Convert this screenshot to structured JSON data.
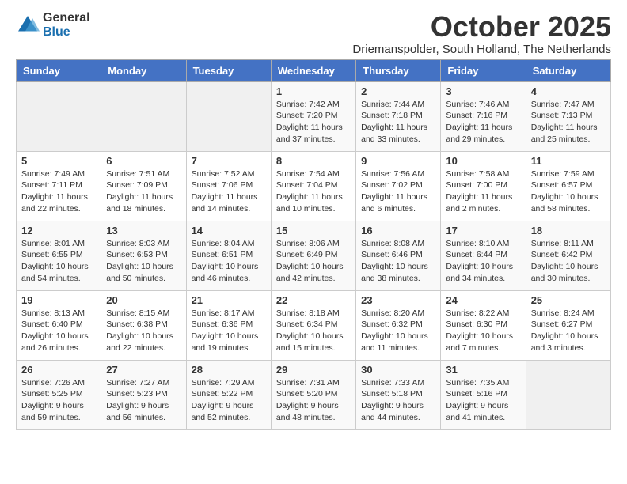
{
  "logo": {
    "general": "General",
    "blue": "Blue"
  },
  "header": {
    "month": "October 2025",
    "location": "Driemanspolder, South Holland, The Netherlands"
  },
  "weekdays": [
    "Sunday",
    "Monday",
    "Tuesday",
    "Wednesday",
    "Thursday",
    "Friday",
    "Saturday"
  ],
  "weeks": [
    [
      {
        "day": "",
        "sunrise": "",
        "sunset": "",
        "daylight": ""
      },
      {
        "day": "",
        "sunrise": "",
        "sunset": "",
        "daylight": ""
      },
      {
        "day": "",
        "sunrise": "",
        "sunset": "",
        "daylight": ""
      },
      {
        "day": "1",
        "sunrise": "Sunrise: 7:42 AM",
        "sunset": "Sunset: 7:20 PM",
        "daylight": "Daylight: 11 hours and 37 minutes."
      },
      {
        "day": "2",
        "sunrise": "Sunrise: 7:44 AM",
        "sunset": "Sunset: 7:18 PM",
        "daylight": "Daylight: 11 hours and 33 minutes."
      },
      {
        "day": "3",
        "sunrise": "Sunrise: 7:46 AM",
        "sunset": "Sunset: 7:16 PM",
        "daylight": "Daylight: 11 hours and 29 minutes."
      },
      {
        "day": "4",
        "sunrise": "Sunrise: 7:47 AM",
        "sunset": "Sunset: 7:13 PM",
        "daylight": "Daylight: 11 hours and 25 minutes."
      }
    ],
    [
      {
        "day": "5",
        "sunrise": "Sunrise: 7:49 AM",
        "sunset": "Sunset: 7:11 PM",
        "daylight": "Daylight: 11 hours and 22 minutes."
      },
      {
        "day": "6",
        "sunrise": "Sunrise: 7:51 AM",
        "sunset": "Sunset: 7:09 PM",
        "daylight": "Daylight: 11 hours and 18 minutes."
      },
      {
        "day": "7",
        "sunrise": "Sunrise: 7:52 AM",
        "sunset": "Sunset: 7:06 PM",
        "daylight": "Daylight: 11 hours and 14 minutes."
      },
      {
        "day": "8",
        "sunrise": "Sunrise: 7:54 AM",
        "sunset": "Sunset: 7:04 PM",
        "daylight": "Daylight: 11 hours and 10 minutes."
      },
      {
        "day": "9",
        "sunrise": "Sunrise: 7:56 AM",
        "sunset": "Sunset: 7:02 PM",
        "daylight": "Daylight: 11 hours and 6 minutes."
      },
      {
        "day": "10",
        "sunrise": "Sunrise: 7:58 AM",
        "sunset": "Sunset: 7:00 PM",
        "daylight": "Daylight: 11 hours and 2 minutes."
      },
      {
        "day": "11",
        "sunrise": "Sunrise: 7:59 AM",
        "sunset": "Sunset: 6:57 PM",
        "daylight": "Daylight: 10 hours and 58 minutes."
      }
    ],
    [
      {
        "day": "12",
        "sunrise": "Sunrise: 8:01 AM",
        "sunset": "Sunset: 6:55 PM",
        "daylight": "Daylight: 10 hours and 54 minutes."
      },
      {
        "day": "13",
        "sunrise": "Sunrise: 8:03 AM",
        "sunset": "Sunset: 6:53 PM",
        "daylight": "Daylight: 10 hours and 50 minutes."
      },
      {
        "day": "14",
        "sunrise": "Sunrise: 8:04 AM",
        "sunset": "Sunset: 6:51 PM",
        "daylight": "Daylight: 10 hours and 46 minutes."
      },
      {
        "day": "15",
        "sunrise": "Sunrise: 8:06 AM",
        "sunset": "Sunset: 6:49 PM",
        "daylight": "Daylight: 10 hours and 42 minutes."
      },
      {
        "day": "16",
        "sunrise": "Sunrise: 8:08 AM",
        "sunset": "Sunset: 6:46 PM",
        "daylight": "Daylight: 10 hours and 38 minutes."
      },
      {
        "day": "17",
        "sunrise": "Sunrise: 8:10 AM",
        "sunset": "Sunset: 6:44 PM",
        "daylight": "Daylight: 10 hours and 34 minutes."
      },
      {
        "day": "18",
        "sunrise": "Sunrise: 8:11 AM",
        "sunset": "Sunset: 6:42 PM",
        "daylight": "Daylight: 10 hours and 30 minutes."
      }
    ],
    [
      {
        "day": "19",
        "sunrise": "Sunrise: 8:13 AM",
        "sunset": "Sunset: 6:40 PM",
        "daylight": "Daylight: 10 hours and 26 minutes."
      },
      {
        "day": "20",
        "sunrise": "Sunrise: 8:15 AM",
        "sunset": "Sunset: 6:38 PM",
        "daylight": "Daylight: 10 hours and 22 minutes."
      },
      {
        "day": "21",
        "sunrise": "Sunrise: 8:17 AM",
        "sunset": "Sunset: 6:36 PM",
        "daylight": "Daylight: 10 hours and 19 minutes."
      },
      {
        "day": "22",
        "sunrise": "Sunrise: 8:18 AM",
        "sunset": "Sunset: 6:34 PM",
        "daylight": "Daylight: 10 hours and 15 minutes."
      },
      {
        "day": "23",
        "sunrise": "Sunrise: 8:20 AM",
        "sunset": "Sunset: 6:32 PM",
        "daylight": "Daylight: 10 hours and 11 minutes."
      },
      {
        "day": "24",
        "sunrise": "Sunrise: 8:22 AM",
        "sunset": "Sunset: 6:30 PM",
        "daylight": "Daylight: 10 hours and 7 minutes."
      },
      {
        "day": "25",
        "sunrise": "Sunrise: 8:24 AM",
        "sunset": "Sunset: 6:27 PM",
        "daylight": "Daylight: 10 hours and 3 minutes."
      }
    ],
    [
      {
        "day": "26",
        "sunrise": "Sunrise: 7:26 AM",
        "sunset": "Sunset: 5:25 PM",
        "daylight": "Daylight: 9 hours and 59 minutes."
      },
      {
        "day": "27",
        "sunrise": "Sunrise: 7:27 AM",
        "sunset": "Sunset: 5:23 PM",
        "daylight": "Daylight: 9 hours and 56 minutes."
      },
      {
        "day": "28",
        "sunrise": "Sunrise: 7:29 AM",
        "sunset": "Sunset: 5:22 PM",
        "daylight": "Daylight: 9 hours and 52 minutes."
      },
      {
        "day": "29",
        "sunrise": "Sunrise: 7:31 AM",
        "sunset": "Sunset: 5:20 PM",
        "daylight": "Daylight: 9 hours and 48 minutes."
      },
      {
        "day": "30",
        "sunrise": "Sunrise: 7:33 AM",
        "sunset": "Sunset: 5:18 PM",
        "daylight": "Daylight: 9 hours and 44 minutes."
      },
      {
        "day": "31",
        "sunrise": "Sunrise: 7:35 AM",
        "sunset": "Sunset: 5:16 PM",
        "daylight": "Daylight: 9 hours and 41 minutes."
      },
      {
        "day": "",
        "sunrise": "",
        "sunset": "",
        "daylight": ""
      }
    ]
  ]
}
